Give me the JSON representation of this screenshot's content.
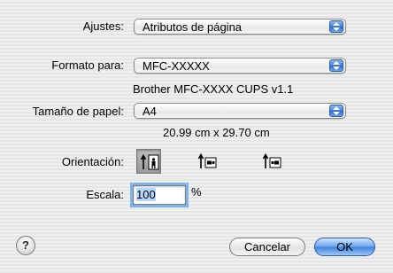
{
  "settings": {
    "label": "Ajustes:",
    "value": "Atributos de página"
  },
  "format": {
    "label": "Formato para:",
    "value": "MFC-XXXXX",
    "driver_info": "Brother MFC-XXXX CUPS v1.1"
  },
  "paper": {
    "label": "Tamaño de papel:",
    "value": "A4",
    "dimensions": "20.99 cm x 29.70 cm"
  },
  "orientation": {
    "label": "Orientación:",
    "selected": "portrait"
  },
  "scale": {
    "label": "Escala:",
    "value": "100",
    "unit": "%"
  },
  "buttons": {
    "help": "?",
    "cancel": "Cancelar",
    "ok": "OK"
  },
  "colors": {
    "accent": "#3c82de",
    "focus_ring": "#7fb1ea"
  }
}
